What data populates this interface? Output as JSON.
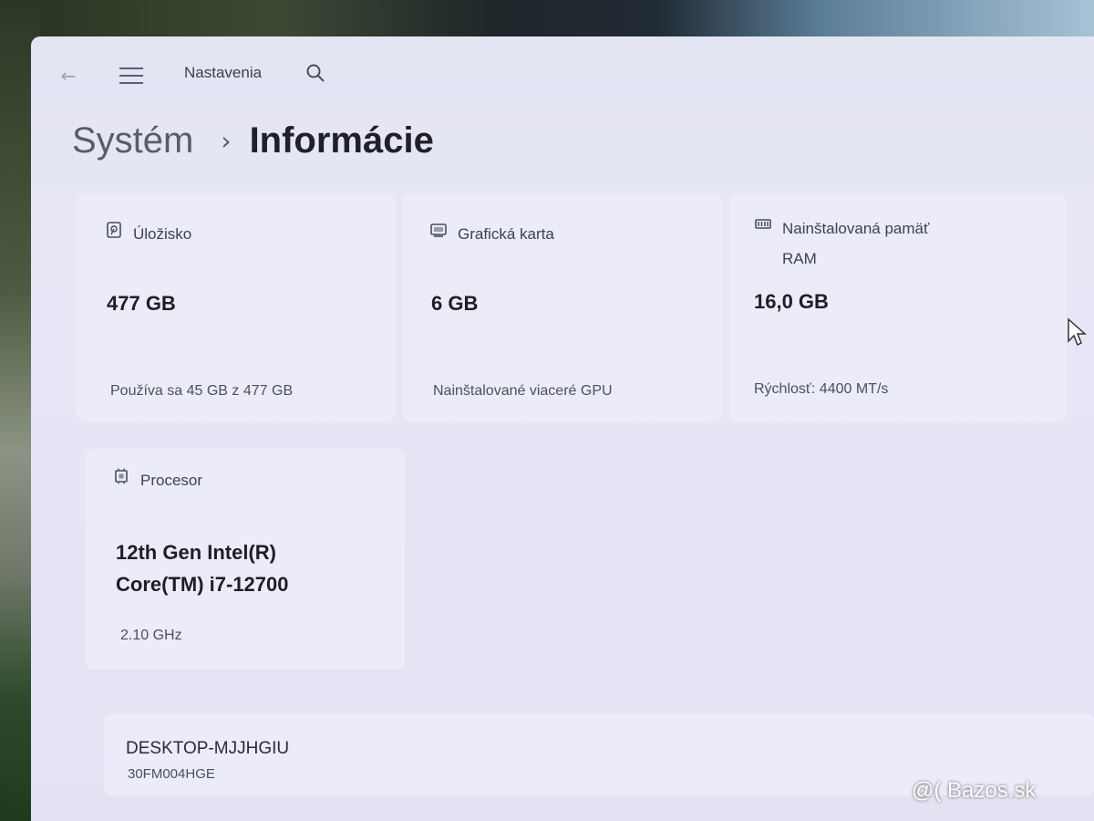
{
  "app": {
    "title": "Nastavenia"
  },
  "breadcrumb": {
    "parent": "Systém",
    "separator": "›",
    "current": "Informácie"
  },
  "cards": {
    "storage": {
      "label": "Úložisko",
      "value": "477 GB",
      "sub": "Používa sa 45 GB z 477 GB",
      "icon": "storage-icon"
    },
    "gpu": {
      "label": "Grafická karta",
      "value": "6 GB",
      "sub": "Nainštalované viaceré GPU",
      "icon": "gpu-icon"
    },
    "ram": {
      "label_line1": "Nainštalovaná pamäť",
      "label_line2": "RAM",
      "value": "16,0 GB",
      "sub": "Rýchlosť: 4400 MT/s",
      "icon": "memory-icon"
    },
    "cpu": {
      "label": "Procesor",
      "value_line1": "12th Gen Intel(R)",
      "value_line2": "Core(TM) i7-12700",
      "sub": "2.10 GHz",
      "icon": "processor-icon"
    }
  },
  "device": {
    "name": "DESKTOP-MJJHGIU",
    "model": "30FM004HGE"
  },
  "watermark": "@( Bazos.sk",
  "colors": {
    "window_bg": "#e5e5f5",
    "text_primary": "#1d1e27",
    "text_secondary": "#4d4f5e"
  }
}
